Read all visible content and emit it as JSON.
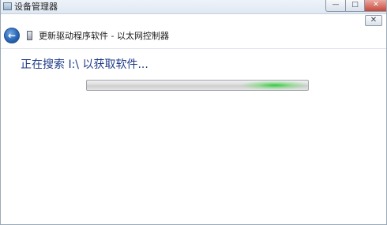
{
  "background_window": {
    "title": "设备管理器",
    "buttons": {
      "minimize": "—",
      "maximize": "□",
      "close": "✕"
    }
  },
  "dialog": {
    "title": "更新驱动程序软件 - 以太网控制器",
    "close_label": "✕",
    "back_icon": "←",
    "status_text": "正在搜索 I:\\ 以获取软件...",
    "progress": {
      "mode": "indeterminate",
      "glow_position": 0.85,
      "color": "#2ec83e"
    }
  }
}
